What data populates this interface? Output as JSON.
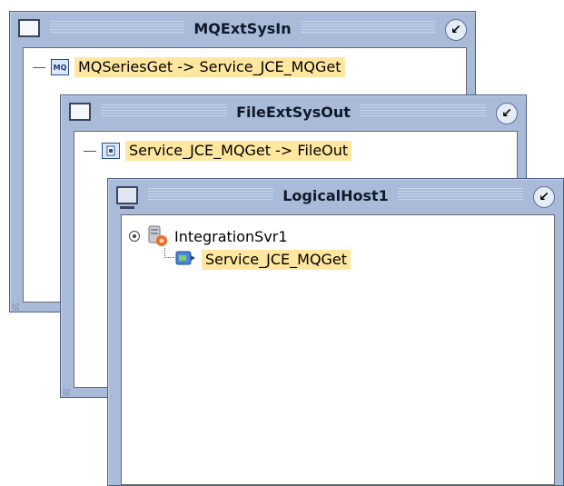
{
  "windows": {
    "mq": {
      "title": "MQExtSysIn",
      "item_label": "MQSeriesGet -> Service_JCE_MQGet",
      "item_icon": "mq-series-icon"
    },
    "file": {
      "title": "FileExtSysOut",
      "item_label": "Service_JCE_MQGet -> FileOut",
      "item_icon": "file-icon"
    },
    "host": {
      "title": "LogicalHost1",
      "server_label": "IntegrationSvr1",
      "service_label": "Service_JCE_MQGet",
      "server_icon": "integration-server-icon",
      "service_icon": "service-icon"
    }
  },
  "colors": {
    "titlebar": "#a9bbd9",
    "highlight": "#ffe7a0",
    "border": "#4b5e86"
  }
}
